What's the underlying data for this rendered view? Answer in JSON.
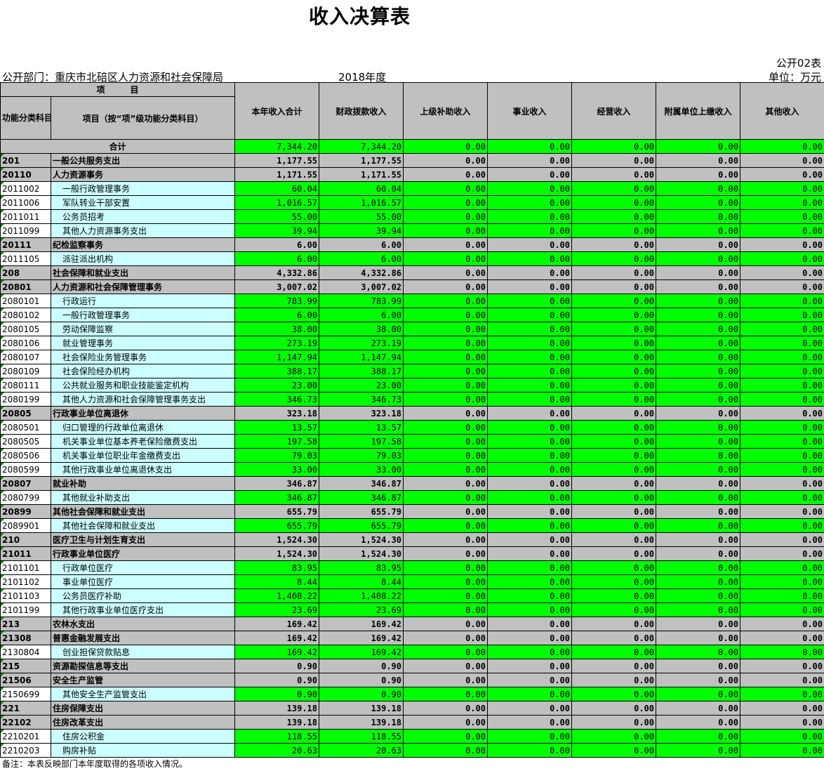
{
  "title": "收入决算表",
  "form_id": "公开02表",
  "dept": "公开部门：重庆市北碚区人力资源和社会保障局",
  "year": "2018年度",
  "unit": "单位：万元",
  "header": {
    "item_group": "项　　　目",
    "code_col": "功能分类科目编码",
    "name_col": "项目（按“项”级功能分类科目）",
    "cols": [
      "本年收入合计",
      "财政拨款收入",
      "上级补助收入",
      "事业收入",
      "经营收入",
      "附属单位上缴收入",
      "其他收入"
    ]
  },
  "total": {
    "label": "合计",
    "values": [
      "7,344.20",
      "7,344.20",
      "0.00",
      "0.00",
      "0.00",
      "0.00",
      "0.00"
    ]
  },
  "rows": [
    {
      "type": "sec",
      "code": "201",
      "name": "一般公共服务支出",
      "values": [
        "1,177.55",
        "1,177.55",
        "0.00",
        "0.00",
        "0.00",
        "0.00",
        "0.00"
      ]
    },
    {
      "type": "sec",
      "code": "20110",
      "name": "人力资源事务",
      "values": [
        "1,171.55",
        "1,171.55",
        "0.00",
        "0.00",
        "0.00",
        "0.00",
        "0.00"
      ]
    },
    {
      "type": "det",
      "code": "2011002",
      "name": "一般行政管理事务",
      "values": [
        "60.04",
        "60.04",
        "0.00",
        "0.00",
        "0.00",
        "0.00",
        "0.00"
      ]
    },
    {
      "type": "det",
      "code": "2011006",
      "name": "军队转业干部安置",
      "values": [
        "1,016.57",
        "1,016.57",
        "0.00",
        "0.00",
        "0.00",
        "0.00",
        "0.00"
      ]
    },
    {
      "type": "det",
      "code": "2011011",
      "name": "公务员招考",
      "values": [
        "55.00",
        "55.00",
        "0.00",
        "0.00",
        "0.00",
        "0.00",
        "0.00"
      ]
    },
    {
      "type": "det",
      "code": "2011099",
      "name": "其他人力资源事务支出",
      "values": [
        "39.94",
        "39.94",
        "0.00",
        "0.00",
        "0.00",
        "0.00",
        "0.00"
      ]
    },
    {
      "type": "sec",
      "code": "20111",
      "name": "纪检监察事务",
      "values": [
        "6.00",
        "6.00",
        "0.00",
        "0.00",
        "0.00",
        "0.00",
        "0.00"
      ]
    },
    {
      "type": "det",
      "code": "2011105",
      "name": "派驻派出机构",
      "values": [
        "6.00",
        "6.00",
        "0.00",
        "0.00",
        "0.00",
        "0.00",
        "0.00"
      ]
    },
    {
      "type": "sec",
      "code": "208",
      "name": "社会保障和就业支出",
      "values": [
        "4,332.86",
        "4,332.86",
        "0.00",
        "0.00",
        "0.00",
        "0.00",
        "0.00"
      ]
    },
    {
      "type": "sec",
      "code": "20801",
      "name": "人力资源和社会保障管理事务",
      "values": [
        "3,007.02",
        "3,007.02",
        "0.00",
        "0.00",
        "0.00",
        "0.00",
        "0.00"
      ]
    },
    {
      "type": "det",
      "code": "2080101",
      "name": "行政运行",
      "values": [
        "783.99",
        "783.99",
        "0.00",
        "0.00",
        "0.00",
        "0.00",
        "0.00"
      ]
    },
    {
      "type": "det",
      "code": "2080102",
      "name": "一般行政管理事务",
      "values": [
        "6.00",
        "6.00",
        "0.00",
        "0.00",
        "0.00",
        "0.00",
        "0.00"
      ]
    },
    {
      "type": "det",
      "code": "2080105",
      "name": "劳动保障监察",
      "values": [
        "38.00",
        "38.00",
        "0.00",
        "0.00",
        "0.00",
        "0.00",
        "0.00"
      ]
    },
    {
      "type": "det",
      "code": "2080106",
      "name": "就业管理事务",
      "values": [
        "273.19",
        "273.19",
        "0.00",
        "0.00",
        "0.00",
        "0.00",
        "0.00"
      ]
    },
    {
      "type": "det",
      "code": "2080107",
      "name": "社会保险业务管理事务",
      "values": [
        "1,147.94",
        "1,147.94",
        "0.00",
        "0.00",
        "0.00",
        "0.00",
        "0.00"
      ]
    },
    {
      "type": "det",
      "code": "2080109",
      "name": "社会保险经办机构",
      "values": [
        "388.17",
        "388.17",
        "0.00",
        "0.00",
        "0.00",
        "0.00",
        "0.00"
      ]
    },
    {
      "type": "det",
      "code": "2080111",
      "name": "公共就业服务和职业技能鉴定机构",
      "values": [
        "23.00",
        "23.00",
        "0.00",
        "0.00",
        "0.00",
        "0.00",
        "0.00"
      ]
    },
    {
      "type": "det",
      "code": "2080199",
      "name": "其他人力资源和社会保障管理事务支出",
      "values": [
        "346.73",
        "346.73",
        "0.00",
        "0.00",
        "0.00",
        "0.00",
        "0.00"
      ]
    },
    {
      "type": "sec",
      "code": "20805",
      "name": "行政事业单位离退休",
      "values": [
        "323.18",
        "323.18",
        "0.00",
        "0.00",
        "0.00",
        "0.00",
        "0.00"
      ]
    },
    {
      "type": "det",
      "code": "2080501",
      "name": "归口管理的行政单位离退休",
      "values": [
        "13.57",
        "13.57",
        "0.00",
        "0.00",
        "0.00",
        "0.00",
        "0.00"
      ]
    },
    {
      "type": "det",
      "code": "2080505",
      "name": "机关事业单位基本养老保险缴费支出",
      "values": [
        "197.58",
        "197.58",
        "0.00",
        "0.00",
        "0.00",
        "0.00",
        "0.00"
      ]
    },
    {
      "type": "det",
      "code": "2080506",
      "name": "机关事业单位职业年金缴费支出",
      "values": [
        "79.03",
        "79.03",
        "0.00",
        "0.00",
        "0.00",
        "0.00",
        "0.00"
      ]
    },
    {
      "type": "det",
      "code": "2080599",
      "name": "其他行政事业单位离退休支出",
      "values": [
        "33.00",
        "33.00",
        "0.00",
        "0.00",
        "0.00",
        "0.00",
        "0.00"
      ]
    },
    {
      "type": "sec",
      "code": "20807",
      "name": "就业补助",
      "values": [
        "346.87",
        "346.87",
        "0.00",
        "0.00",
        "0.00",
        "0.00",
        "0.00"
      ]
    },
    {
      "type": "det",
      "code": "2080799",
      "name": "其他就业补助支出",
      "values": [
        "346.87",
        "346.87",
        "0.00",
        "0.00",
        "0.00",
        "0.00",
        "0.00"
      ]
    },
    {
      "type": "sec",
      "code": "20899",
      "name": "其他社会保障和就业支出",
      "values": [
        "655.79",
        "655.79",
        "0.00",
        "0.00",
        "0.00",
        "0.00",
        "0.00"
      ]
    },
    {
      "type": "det",
      "code": "2089901",
      "name": "其他社会保障和就业支出",
      "values": [
        "655.79",
        "655.79",
        "0.00",
        "0.00",
        "0.00",
        "0.00",
        "0.00"
      ]
    },
    {
      "type": "sec",
      "code": "210",
      "name": "医疗卫生与计划生育支出",
      "values": [
        "1,524.30",
        "1,524.30",
        "0.00",
        "0.00",
        "0.00",
        "0.00",
        "0.00"
      ]
    },
    {
      "type": "sec",
      "code": "21011",
      "name": "行政事业单位医疗",
      "values": [
        "1,524.30",
        "1,524.30",
        "0.00",
        "0.00",
        "0.00",
        "0.00",
        "0.00"
      ]
    },
    {
      "type": "det",
      "code": "2101101",
      "name": "行政单位医疗",
      "values": [
        "83.95",
        "83.95",
        "0.00",
        "0.00",
        "0.00",
        "0.00",
        "0.00"
      ]
    },
    {
      "type": "det",
      "code": "2101102",
      "name": "事业单位医疗",
      "values": [
        "8.44",
        "8.44",
        "0.00",
        "0.00",
        "0.00",
        "0.00",
        "0.00"
      ]
    },
    {
      "type": "det",
      "code": "2101103",
      "name": "公务员医疗补助",
      "values": [
        "1,408.22",
        "1,408.22",
        "0.00",
        "0.00",
        "0.00",
        "0.00",
        "0.00"
      ]
    },
    {
      "type": "det",
      "code": "2101199",
      "name": "其他行政事业单位医疗支出",
      "values": [
        "23.69",
        "23.69",
        "0.00",
        "0.00",
        "0.00",
        "0.00",
        "0.00"
      ]
    },
    {
      "type": "sec",
      "code": "213",
      "name": "农林水支出",
      "values": [
        "169.42",
        "169.42",
        "0.00",
        "0.00",
        "0.00",
        "0.00",
        "0.00"
      ]
    },
    {
      "type": "sec",
      "code": "21308",
      "name": "普惠金融发展支出",
      "values": [
        "169.42",
        "169.42",
        "0.00",
        "0.00",
        "0.00",
        "0.00",
        "0.00"
      ]
    },
    {
      "type": "det",
      "code": "2130804",
      "name": "创业担保贷款贴息",
      "values": [
        "169.42",
        "169.42",
        "0.00",
        "0.00",
        "0.00",
        "0.00",
        "0.00"
      ]
    },
    {
      "type": "sec",
      "code": "215",
      "name": "资源勘探信息等支出",
      "values": [
        "0.90",
        "0.90",
        "0.00",
        "0.00",
        "0.00",
        "0.00",
        "0.00"
      ]
    },
    {
      "type": "sec",
      "code": "21506",
      "name": "安全生产监管",
      "values": [
        "0.90",
        "0.90",
        "0.00",
        "0.00",
        "0.00",
        "0.00",
        "0.00"
      ]
    },
    {
      "type": "det",
      "code": "2150699",
      "name": "其他安全生产监管支出",
      "values": [
        "0.90",
        "0.90",
        "0.00",
        "0.00",
        "0.00",
        "0.00",
        "0.00"
      ]
    },
    {
      "type": "sec",
      "code": "221",
      "name": "住房保障支出",
      "values": [
        "139.18",
        "139.18",
        "0.00",
        "0.00",
        "0.00",
        "0.00",
        "0.00"
      ]
    },
    {
      "type": "sec",
      "code": "22102",
      "name": "住房改革支出",
      "values": [
        "139.18",
        "139.18",
        "0.00",
        "0.00",
        "0.00",
        "0.00",
        "0.00"
      ]
    },
    {
      "type": "det",
      "code": "2210201",
      "name": "住房公积金",
      "values": [
        "118.55",
        "118.55",
        "0.00",
        "0.00",
        "0.00",
        "0.00",
        "0.00"
      ]
    },
    {
      "type": "det",
      "code": "2210203",
      "name": "购房补贴",
      "values": [
        "20.63",
        "20.63",
        "0.00",
        "0.00",
        "0.00",
        "0.00",
        "0.00"
      ]
    }
  ],
  "note": "备注：本表反映部门本年度取得的各项收入情况。",
  "colors": {
    "header_bg": "#c0c0c0",
    "num_bg": "#00ff00",
    "detail_name_bg": "#ccffff",
    "marker": "#0a8a0a"
  }
}
